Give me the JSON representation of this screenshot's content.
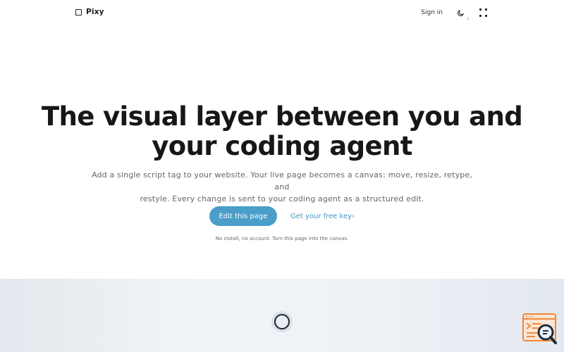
{
  "nav": {
    "brand": "Pixy",
    "signin": "Sign in",
    "theme_sub": "s"
  },
  "hero": {
    "headline_line1": "The visual layer between you and",
    "headline_line2": "your coding agent",
    "subtext_line1": "Add a single script tag to your website. Your live page becomes a canvas: move, resize, retype, and",
    "subtext_line2": "restyle. Every change is sent to your coding agent as a structured edit.",
    "primary_cta": "Edit this page",
    "secondary_cta": "Get your free key›",
    "note": "No install, no account. Turn this page into the canvas."
  },
  "icons": {
    "brand": "square-logo-icon",
    "theme": "moon-icon",
    "menu": "dots-grid-icon",
    "loader": "ring-loader-icon",
    "widget": "code-search-icon"
  },
  "colors": {
    "accent": "#4a9ec9",
    "link": "#3f97c2",
    "widget_orange": "#f0883e"
  }
}
